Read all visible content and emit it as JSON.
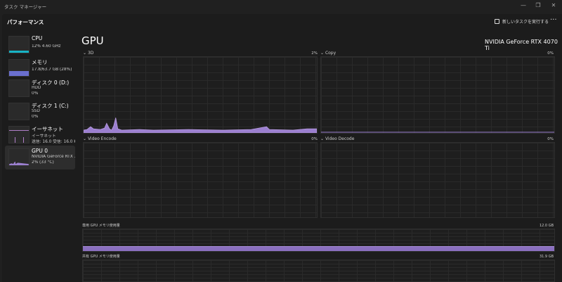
{
  "window": {
    "title": "タスク マネージャー",
    "minimize": "—",
    "restore": "❐",
    "close": "✕"
  },
  "header": {
    "title": "パフォーマンス",
    "run_task": "新しいタスクを実行する",
    "more": "···"
  },
  "sidebar": {
    "items": [
      {
        "name": "CPU",
        "sub1": "12% 4.60 GHz",
        "sub2": ""
      },
      {
        "name": "メモリ",
        "sub1": "17.8/63.7 GB (28%)",
        "sub2": ""
      },
      {
        "name": "ディスク 0 (D:)",
        "sub1": "HDD",
        "sub2": "0%"
      },
      {
        "name": "ディスク 1 (C:)",
        "sub1": "SSD",
        "sub2": "0%"
      },
      {
        "name": "イーサネット",
        "sub1": "イーサネット",
        "sub2": "送信: 16.0 受信: 16.0 Kl"
      },
      {
        "name": "GPU 0",
        "sub1": "NVIDIA GeForce RTX ...",
        "sub2": "2% (33 °C)"
      }
    ]
  },
  "main": {
    "title": "GPU",
    "device": "NVIDIA GeForce RTX 4070 Ti",
    "engines": [
      {
        "label": "3D",
        "value": "2%"
      },
      {
        "label": "Copy",
        "value": "0%"
      },
      {
        "label": "Video Encode",
        "value": "0%"
      },
      {
        "label": "Video Decode",
        "value": "0%"
      }
    ],
    "dedicated": {
      "label": "専用 GPU メモリ使用量",
      "value": "12.0 GB"
    },
    "shared": {
      "label": "共有 GPU メモリ使用量",
      "value": "31.9 GB"
    }
  },
  "colors": {
    "gpu": "#9b7fcf",
    "cpu": "#17b3c4",
    "memory": "#6a6fcf",
    "ethernet": "#b07fc8"
  }
}
